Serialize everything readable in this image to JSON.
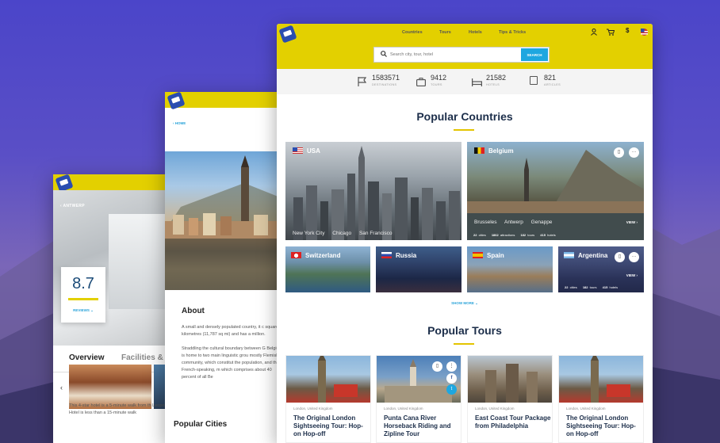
{
  "colors": {
    "accent_yellow": "#e3d000",
    "link_blue": "#29a3d9",
    "title_navy": "#1c2e4a"
  },
  "hotel": {
    "back_label": "ANTWERP",
    "score": "8.7",
    "reviews_label": "REVIEWS",
    "tabs": [
      "Overview",
      "Facilities &"
    ],
    "description": "This 4-star hotel is a 5-minute walk from th Leopold Hotel is less than a 15-minute walk"
  },
  "country": {
    "back_label": "HOME",
    "about_title": "About",
    "about_p1": "A small and densely populated country, it c square kilometres (11,787 sq mi) and has a million.",
    "about_p2": "Straddling the cultural boundary between G Belgium is home to two main linguistic grou mostly Flemish community, which constitut the population, and the French-speaking, m which comprises about 40 percent of all Be",
    "popular_cities": "Popular Cities"
  },
  "home": {
    "nav": [
      "Countries",
      "Tours",
      "Hotels",
      "Tips & Tricks"
    ],
    "nav_icons": [
      "user-icon",
      "cart-icon",
      "currency-icon",
      "flag-icon"
    ],
    "currency_symbol": "$",
    "search": {
      "placeholder": "Search city, tour, hotel",
      "button": "SEARCH"
    },
    "stats": [
      {
        "icon": "flag-icon",
        "value": "1583571",
        "label": "DESTINATIONS"
      },
      {
        "icon": "briefcase-icon",
        "value": "9412",
        "label": "TOURS"
      },
      {
        "icon": "bed-icon",
        "value": "21582",
        "label": "HOTELS"
      },
      {
        "icon": "article-icon",
        "value": "821",
        "label": "ARTICLES"
      }
    ],
    "popular_countries_title": "Popular Countries",
    "countries": {
      "usa": {
        "name": "USA",
        "cities": [
          "New York City",
          "Chicago",
          "San Francisco"
        ]
      },
      "belgium": {
        "name": "Belgium",
        "cities": [
          "Brusseles",
          "Antwerp",
          "Genappe"
        ],
        "cities_count": "22",
        "cities_label": "cities",
        "attractions_count": "1862",
        "attractions_label": "attractions",
        "tours_count": "182",
        "tours_label": "tours",
        "hotels_count": "415",
        "hotels_label": "hotels",
        "view": "VIEW"
      },
      "switzerland": {
        "name": "Switzerland"
      },
      "russia": {
        "name": "Russia"
      },
      "spain": {
        "name": "Spain"
      },
      "argentina": {
        "name": "Argentina",
        "cities_count": "22",
        "cities_label": "cities",
        "tours_count": "182",
        "tours_label": "tours",
        "hotels_count": "415",
        "hotels_label": "hotels",
        "view": "VIEW"
      }
    },
    "show_more": "SHOW MORE",
    "popular_tours_title": "Popular Tours",
    "tours": [
      {
        "location": "London, United Kingdom",
        "title": "The Original London Sightseeing Tour: Hop-on Hop-off"
      },
      {
        "location": "London, United Kingdom",
        "title": "Punta Cana River Horseback Riding and Zipline Tour"
      },
      {
        "location": "London, United Kingdom",
        "title": "East Coast Tour Package from Philadelphia"
      },
      {
        "location": "London, United Kingdom",
        "title": "The Original London Sightseeing Tour: Hop-on Hop-off"
      }
    ]
  }
}
